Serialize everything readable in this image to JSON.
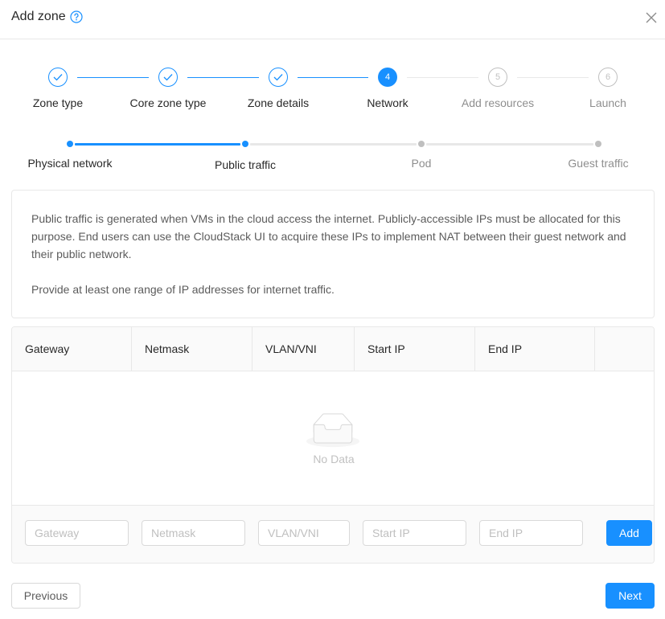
{
  "dialog": {
    "title": "Add zone"
  },
  "steps": [
    {
      "label": "Zone type",
      "status": "done",
      "number": "1"
    },
    {
      "label": "Core zone type",
      "status": "done",
      "number": "2"
    },
    {
      "label": "Zone details",
      "status": "done",
      "number": "3"
    },
    {
      "label": "Network",
      "status": "active",
      "number": "4"
    },
    {
      "label": "Add resources",
      "status": "wait",
      "number": "5"
    },
    {
      "label": "Launch",
      "status": "wait",
      "number": "6"
    }
  ],
  "sub_steps": [
    {
      "label": "Physical network",
      "status": "done"
    },
    {
      "label": "Public traffic",
      "status": "active"
    },
    {
      "label": "Pod",
      "status": "wait"
    },
    {
      "label": "Guest traffic",
      "status": "wait"
    }
  ],
  "description": {
    "paragraph1": "Public traffic is generated when VMs in the cloud access the internet. Publicly-accessible IPs must be allocated for this purpose. End users can use the CloudStack UI to acquire these IPs to implement NAT between their guest network and their public network.",
    "paragraph2": "Provide at least one range of IP addresses for internet traffic."
  },
  "table": {
    "columns": [
      "Gateway",
      "Netmask",
      "VLAN/VNI",
      "Start IP",
      "End IP",
      ""
    ],
    "empty_text": "No Data"
  },
  "form": {
    "gateway_placeholder": "Gateway",
    "netmask_placeholder": "Netmask",
    "vlan_placeholder": "VLAN/VNI",
    "start_ip_placeholder": "Start IP",
    "end_ip_placeholder": "End IP",
    "add_label": "Add"
  },
  "footer": {
    "previous_label": "Previous",
    "next_label": "Next"
  },
  "colors": {
    "primary": "#1890ff",
    "border": "#e8e8e8",
    "muted": "#bfbfbf"
  }
}
